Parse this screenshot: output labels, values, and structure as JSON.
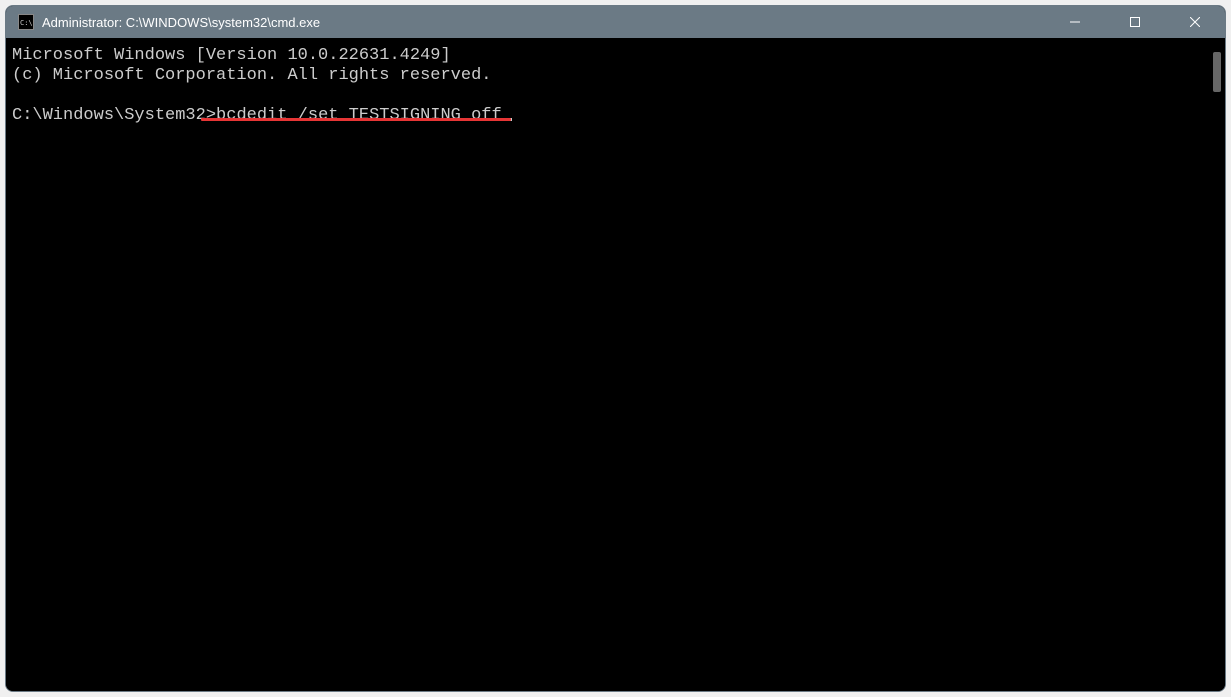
{
  "window": {
    "title": "Administrator: C:\\WINDOWS\\system32\\cmd.exe"
  },
  "terminal": {
    "line1": "Microsoft Windows [Version 10.0.22631.4249]",
    "line2": "(c) Microsoft Corporation. All rights reserved.",
    "blank": "",
    "prompt": "C:\\Windows\\System32>",
    "command": "bcdedit /set TESTSIGNING off"
  },
  "icons": {
    "cmd": "cmd-icon",
    "minimize": "minimize-icon",
    "maximize": "maximize-icon",
    "close": "close-icon"
  },
  "annotation": {
    "color": "#e63535"
  }
}
